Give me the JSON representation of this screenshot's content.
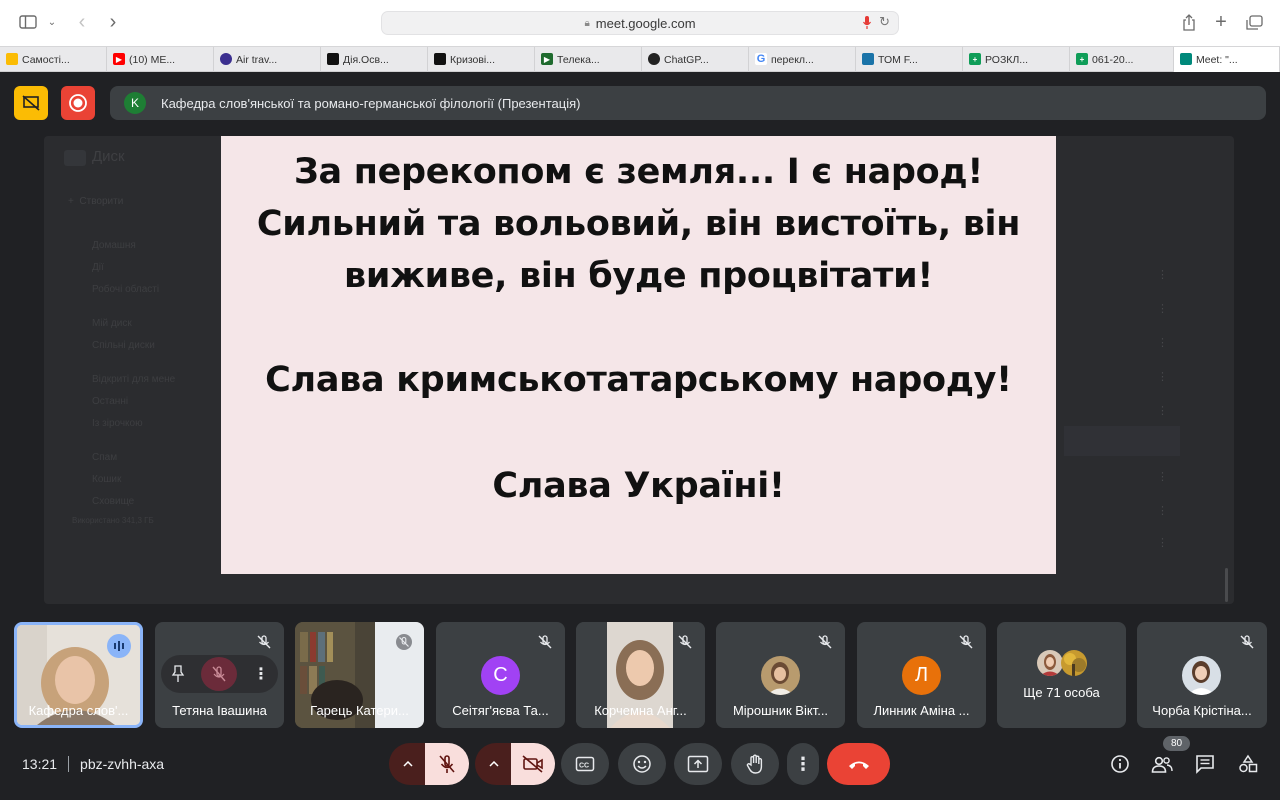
{
  "browser": {
    "address": "meet.google.com",
    "tabs": [
      {
        "label": "Самості...",
        "color": "#fbbc04"
      },
      {
        "label": "(10) ME...",
        "color": "#ff0000"
      },
      {
        "label": "Air trav...",
        "color": "#3b2f8f"
      },
      {
        "label": "Дія.Осв...",
        "color": "#111111"
      },
      {
        "label": "Кризові...",
        "color": "#111111"
      },
      {
        "label": "Телека...",
        "color": "#1f6b2e"
      },
      {
        "label": "ChatGP...",
        "color": "#222222"
      },
      {
        "label": "перекл...",
        "color": "#4285f4"
      },
      {
        "label": "ТОМ F...",
        "color": "#1a73a8"
      },
      {
        "label": "РОЗКЛ...",
        "color": "#0f9d58"
      },
      {
        "label": "061-20...",
        "color": "#0f9d58"
      },
      {
        "label": "Meet: \"...",
        "color": "#00897b"
      }
    ]
  },
  "meeting": {
    "presenter_initial": "K",
    "title": "Кафедра слов'янської та романо-германської філології (Презентація)",
    "time": "13:21",
    "code": "pbz-zvhh-axa",
    "participants_count": "80"
  },
  "slide": {
    "lines": [
      "За перекопом є земля... І є народ!",
      "Сильний та вольовий, він вистоїть, він",
      "виживе, він буде процвітати!",
      "Слава кримськотатарському народу!",
      "Слава Україні!"
    ]
  },
  "drive_ghost": {
    "app": "Диск",
    "create": "Створити",
    "items": [
      "Домашня",
      "Дії",
      "Робочі області",
      "Мій диск",
      "Спільні диски",
      "Відкриті для мене",
      "Останні",
      "Із зірочкою",
      "Спам",
      "Кошик",
      "Сховище"
    ],
    "storage": "Використано 341,3 ГБ"
  },
  "participants": [
    {
      "name": "Кафедра слов'...",
      "initial": "",
      "color": "#e8e3dd"
    },
    {
      "name": "Тетяна Івашина",
      "initial": "",
      "color": "#3c4043"
    },
    {
      "name": "Гарець Катери...",
      "initial": "",
      "color": "#3c4043"
    },
    {
      "name": "Сеітяг'яєва Та...",
      "initial": "C",
      "color": "#a142f4"
    },
    {
      "name": "Корчемна Анг...",
      "initial": "",
      "color": "#3c4043"
    },
    {
      "name": "Мірошник Вікт...",
      "initial": "",
      "color": "#3c4043"
    },
    {
      "name": "Линник Аміна ...",
      "initial": "Л",
      "color": "#e8710a"
    },
    {
      "name": "Ще 71 особа",
      "initial": "",
      "color": "#3c4043"
    },
    {
      "name": "Чорба Крістіна...",
      "initial": "",
      "color": "#3c4043"
    }
  ]
}
